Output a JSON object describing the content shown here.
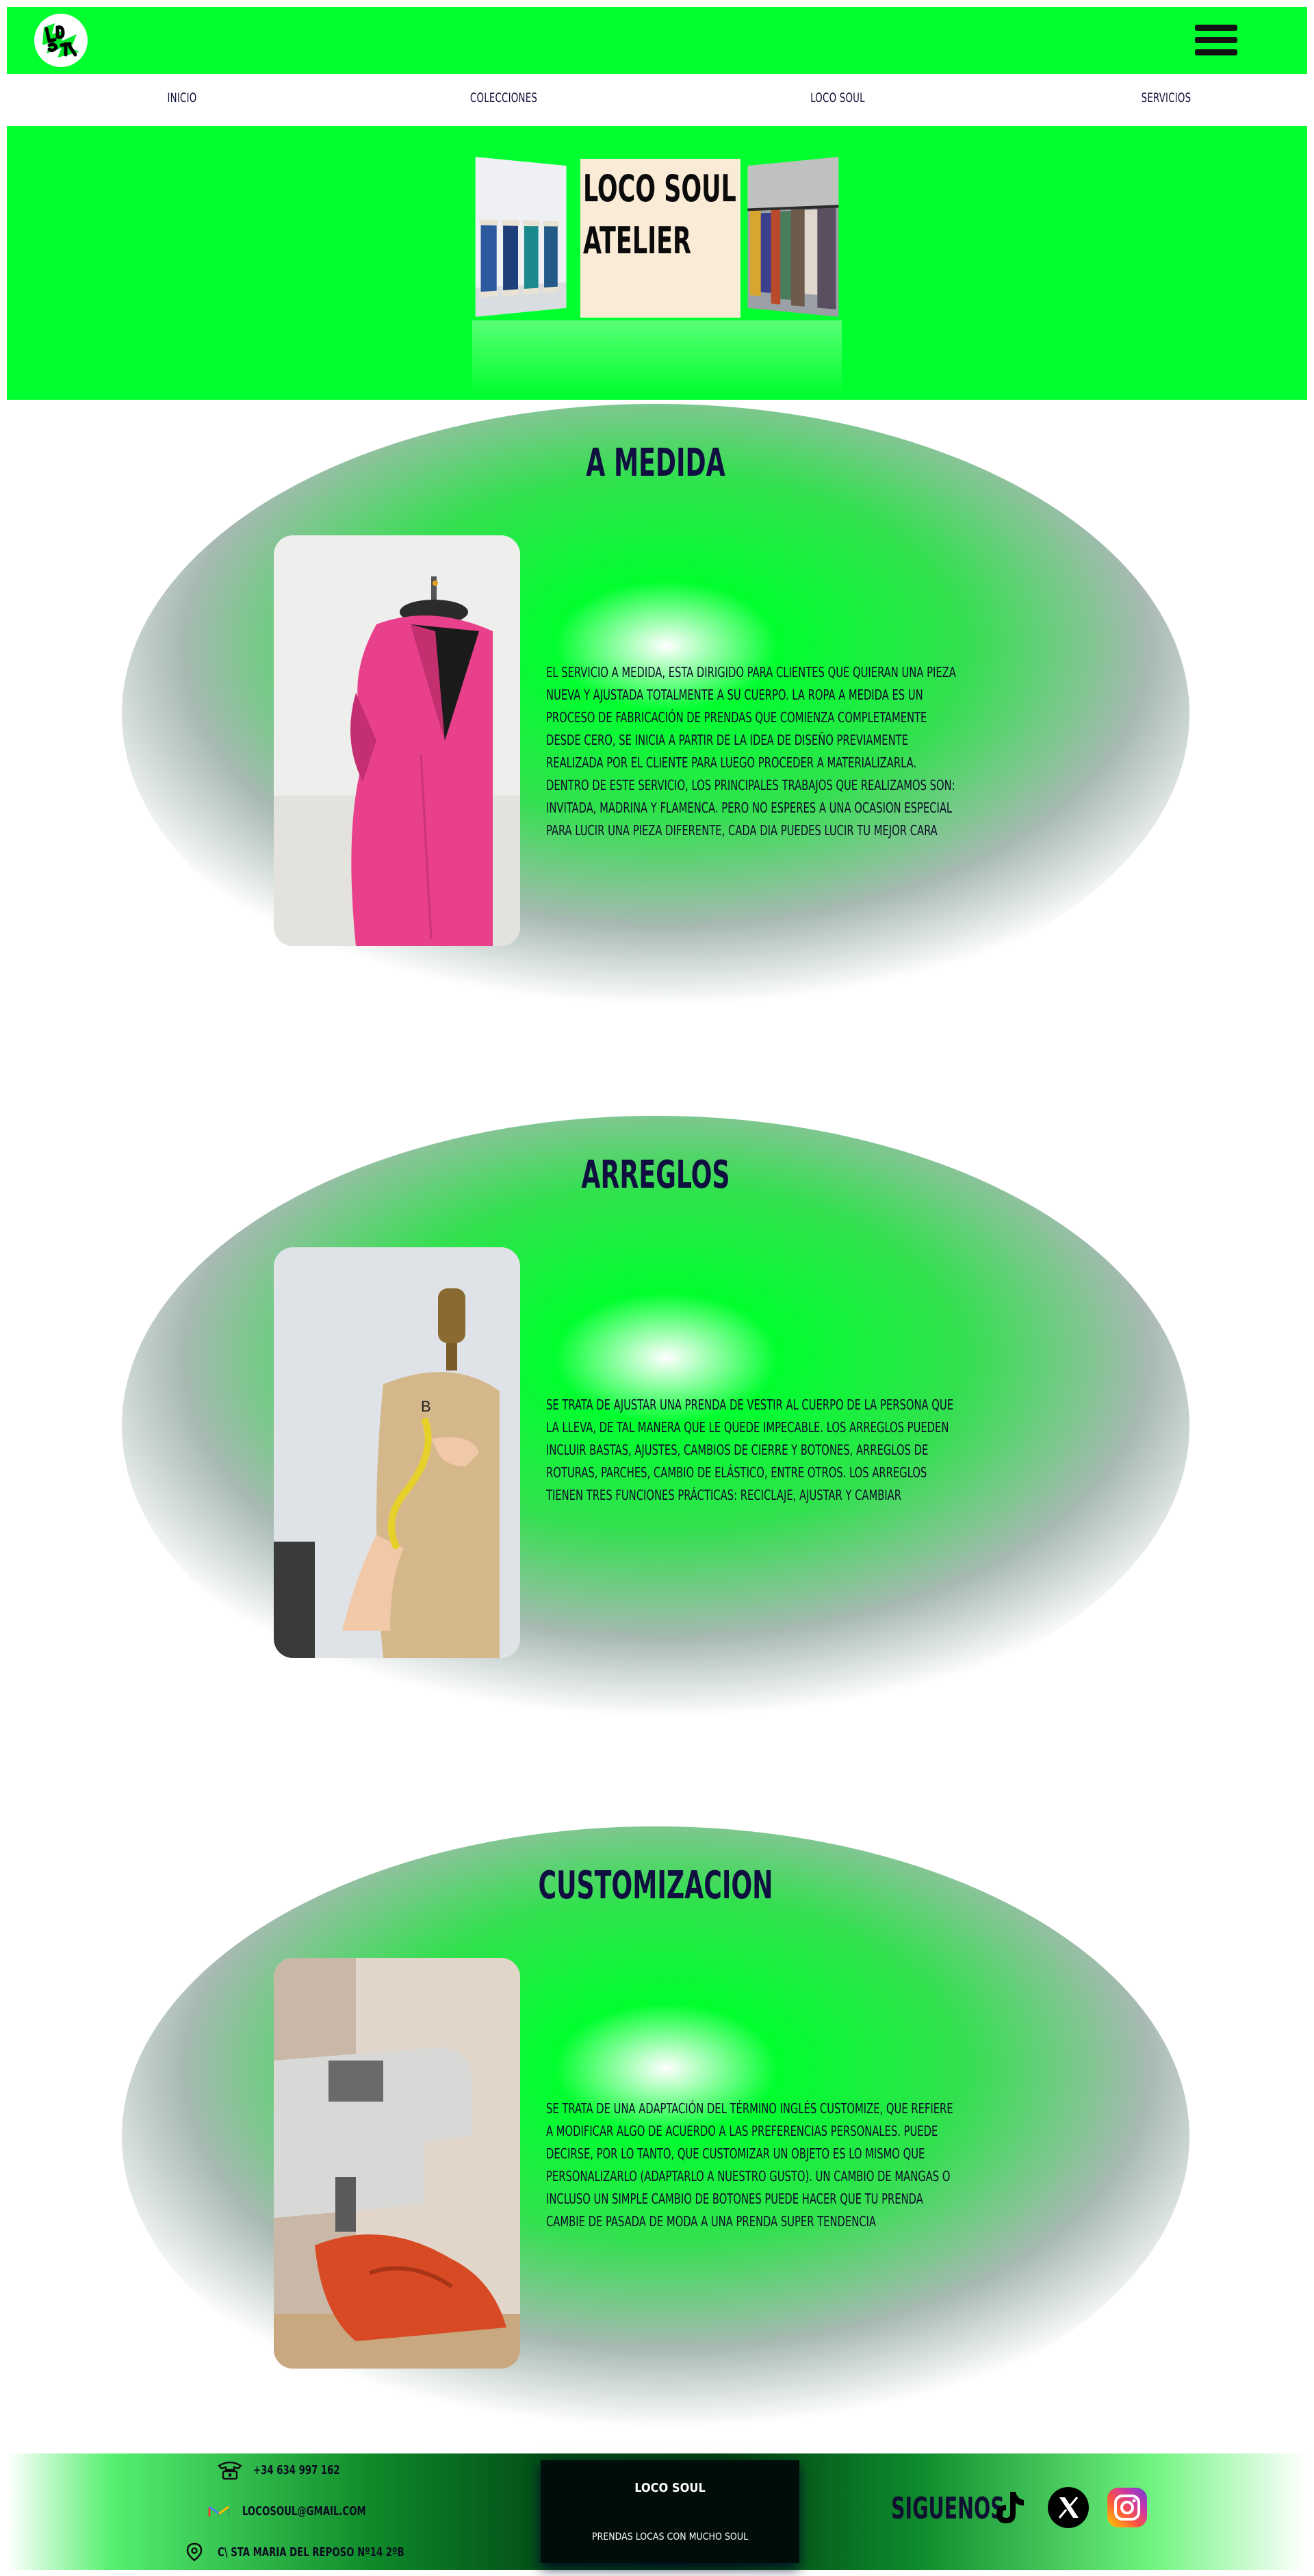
{
  "brand": {
    "logo_alt": "LOCO SOUL logo"
  },
  "nav": {
    "items": [
      {
        "label": "INICIO"
      },
      {
        "label": "COLECCIONES"
      },
      {
        "label": "LOCO SOUL"
      },
      {
        "label": "SERVICIOS"
      }
    ]
  },
  "hero": {
    "title_line1": "LOCO SOUL",
    "title_line2": "ATELIER"
  },
  "sections": [
    {
      "title": "A MEDIDA",
      "text": "El servicio a medida, esta dirigido para clientes que quieran una pieza nueva y ajustada totalmente a su cuerpo. La ropa a medida es un proceso de fabricación de prendas que comienza completamente desde cero, se inicia a partir de la idea de diseño previamente realizada por el cliente para luego proceder a materializarla. Dentro de este servicio, los principales trabajos que realizamos son: invitada, madrina y flamenca. Pero no esperes a una ocasion especial para lucir una pieza diferente, cada dia puedes lucir tu mejor cara"
    },
    {
      "title": "ARREGLOS",
      "text": "Se trata de ajustar una prenda de vestir al cuerpo de la persona que la lleva, de tal manera que le quede impecable. Los arreglos pueden incluir bastas, ajustes, cambios de cierre y botones, arreglos de roturas, parches, cambio de elástico, entre otros. Los arreglos tienen tres funciones prácticas: reciclaje, ajustar y cambiar"
    },
    {
      "title": "CUSTOMIZACION",
      "text": "Se trata de una adaptación del término inglés customize, que refiere a modificar algo de acuerdo a las preferencias personales. Puede decirse, por lo tanto, que customizar un objeto es lo mismo que personalizarlo (adaptarlo a nuestro gusto). Un cambio de mangas o incluso un simple cambio de botones puede hacer que tu prenda cambie de pasada de moda a una prenda super tendencia"
    }
  ],
  "footer": {
    "phone": "+34 634 997 162",
    "email": "LOCOSOUL@GMAIL.COM",
    "address": "C\\ STA MARIA DEL REPOSO Nº14 2ºB",
    "card_title": "LOCO SOUL",
    "card_subtitle": "PRENDAS LOCAS CON MUCHO SOUL",
    "follow_label": "SIGUENOS"
  },
  "icons": [
    "menu-icon",
    "phone-icon",
    "mail-icon",
    "location-icon",
    "tiktok-icon",
    "x-icon",
    "instagram-icon"
  ],
  "colors": {
    "accent_green": "#00ff2e",
    "heading_navy": "#101040",
    "footer_dark": "#000d0a"
  }
}
